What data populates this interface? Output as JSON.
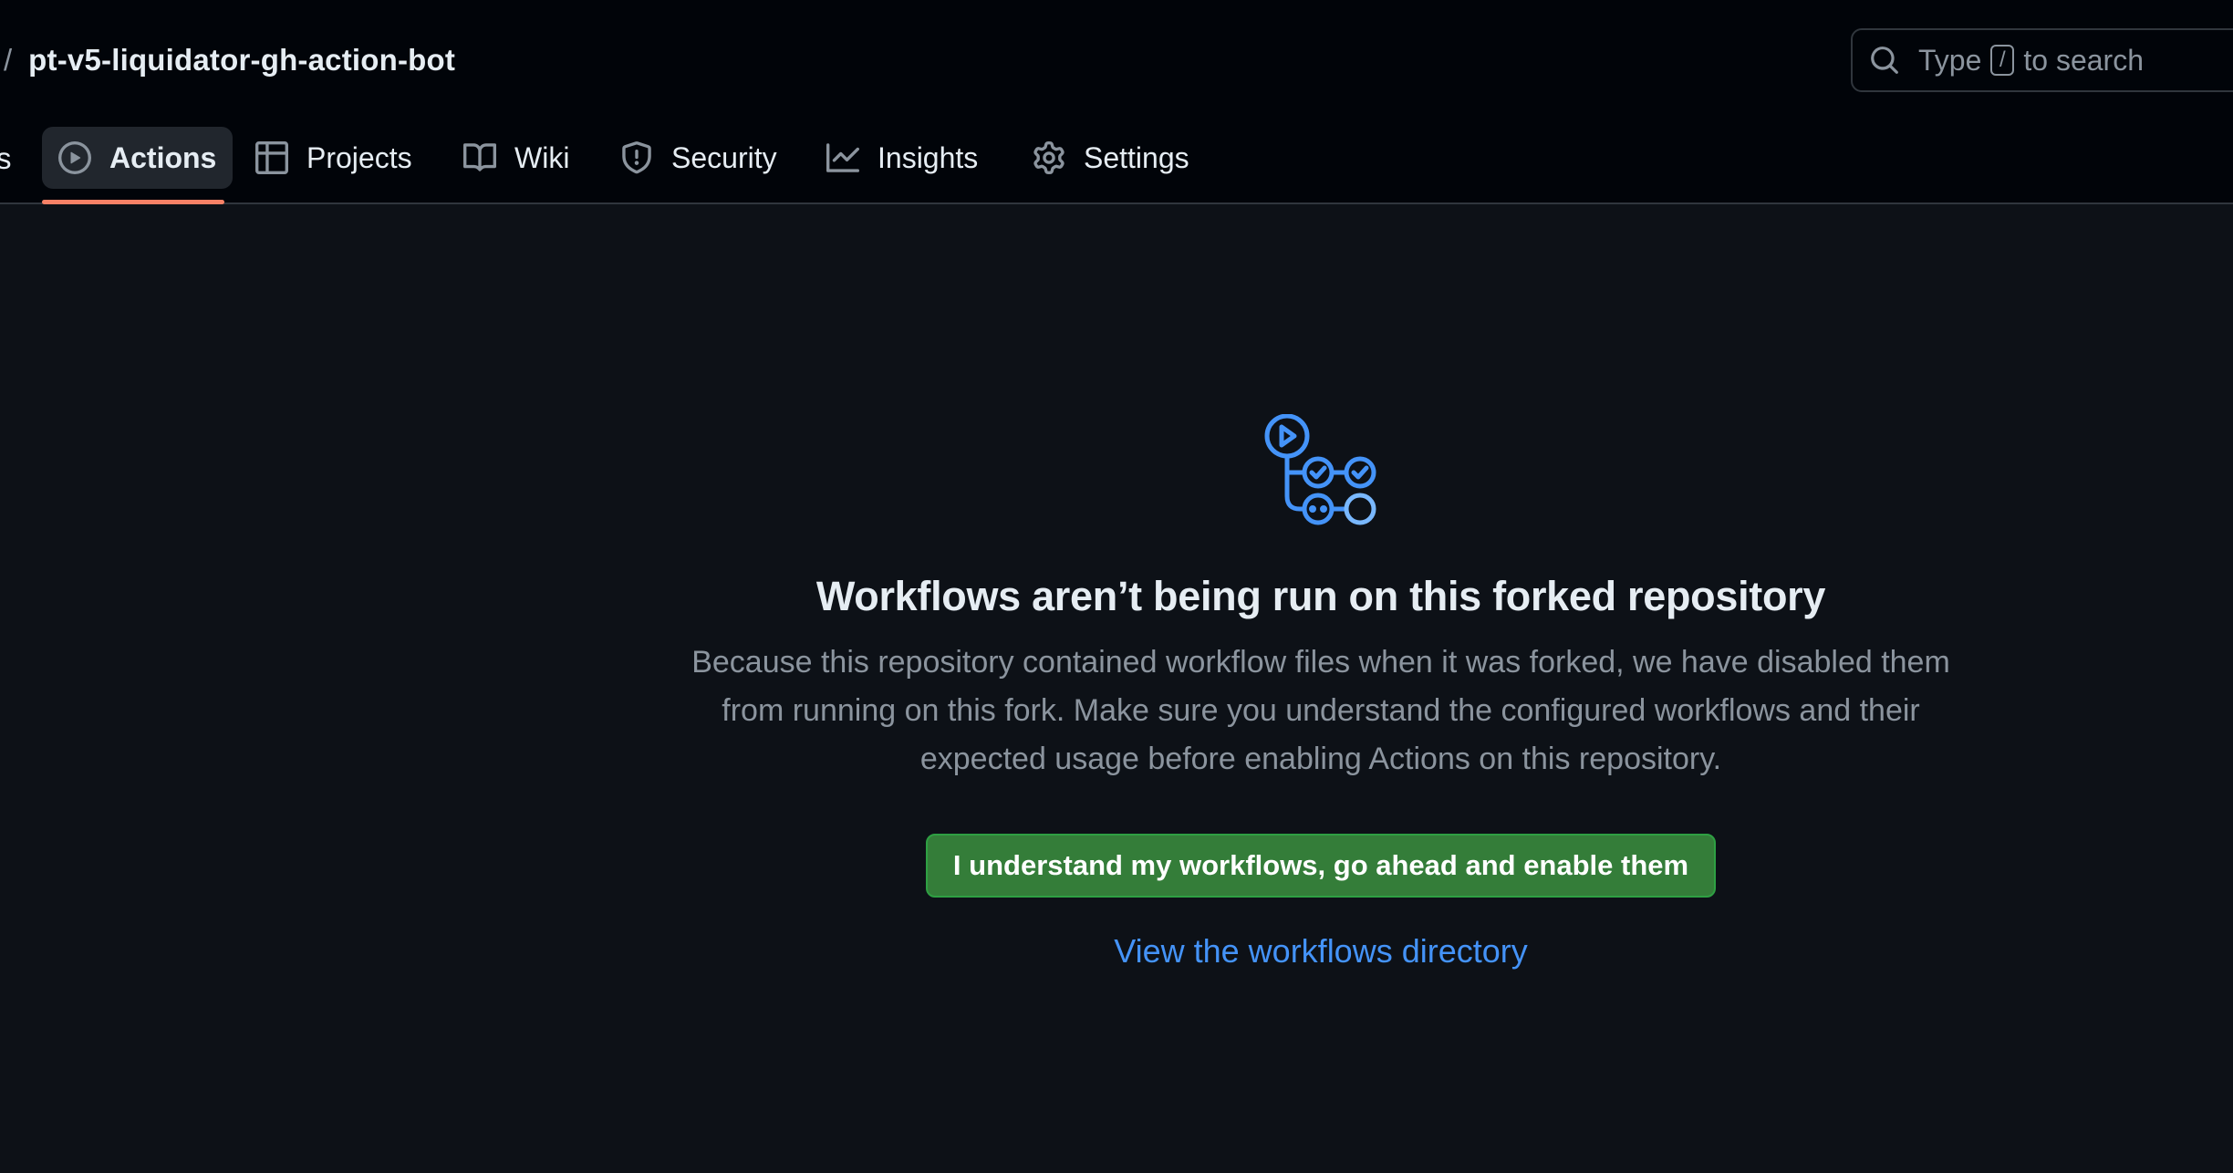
{
  "header": {
    "path_separator": "/",
    "repo_name": "pt-v5-liquidator-gh-action-bot",
    "search": {
      "prefix": "Type",
      "key": "/",
      "suffix": "to search"
    }
  },
  "tabs": {
    "cut_label": "s",
    "items": [
      {
        "label": "Actions",
        "icon": "play-icon",
        "active": true
      },
      {
        "label": "Projects",
        "icon": "table-icon",
        "active": false
      },
      {
        "label": "Wiki",
        "icon": "book-icon",
        "active": false
      },
      {
        "label": "Security",
        "icon": "shield-icon",
        "active": false
      },
      {
        "label": "Insights",
        "icon": "graph-icon",
        "active": false
      },
      {
        "label": "Settings",
        "icon": "gear-icon",
        "active": false
      }
    ],
    "active_underline_color": "#f78166"
  },
  "blankslate": {
    "icon": "workflow-icon",
    "title": "Workflows aren’t being run on this forked repository",
    "description_lines": [
      "Because this repository contained workflow files when it was forked, we have disabled them",
      "from running on this fork. Make sure you understand the configured workflows and their",
      "expected usage before enabling Actions on this repository."
    ],
    "enable_button_label": "I understand my workflows, go ahead and enable them",
    "directory_link_label": "View the workflows directory"
  },
  "colors": {
    "header_bg": "#010409",
    "page_bg": "#0d1117",
    "accent_blue": "#4493f8",
    "button_green": "#347d39",
    "muted_text": "#8b949e"
  }
}
